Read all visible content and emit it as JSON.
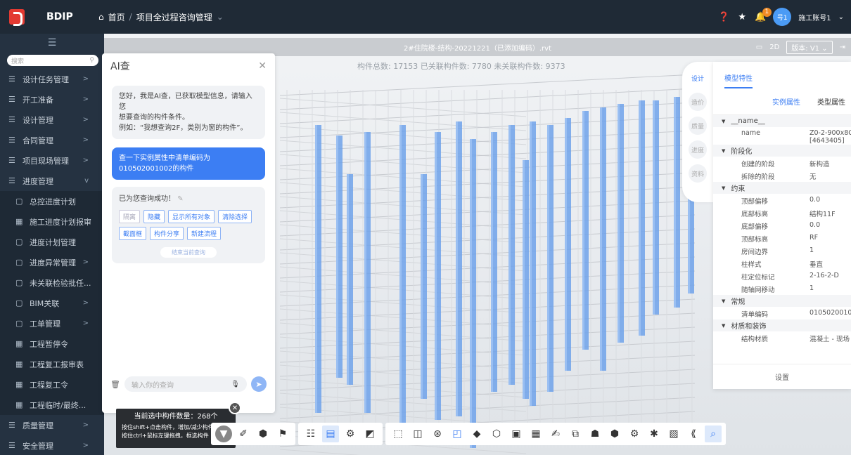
{
  "app": {
    "brand": "BDIP"
  },
  "breadcrumb": {
    "home": "首页",
    "separator": "/",
    "current": "项目全过程咨询管理"
  },
  "topright": {
    "notification_count": "1",
    "avatar_text": "号1",
    "user_name": "施工账号1"
  },
  "sidebar": {
    "search_placeholder": "搜索",
    "items": [
      {
        "label": "设计任务管理",
        "icon": "list-icon",
        "arrow": ">"
      },
      {
        "label": "开工准备",
        "icon": "list-icon",
        "arrow": ">"
      },
      {
        "label": "设计管理",
        "icon": "list-icon",
        "arrow": ">"
      },
      {
        "label": "合同管理",
        "icon": "list-icon",
        "arrow": ">"
      },
      {
        "label": "项目现场管理",
        "icon": "list-icon",
        "arrow": ">"
      },
      {
        "label": "进度管理",
        "icon": "list-icon",
        "arrow": "v"
      },
      {
        "label": "总控进度计划",
        "icon": "doc-icon",
        "arrow": "",
        "sub": true
      },
      {
        "label": "施工进度计划报审",
        "icon": "table-icon",
        "arrow": "",
        "sub": true
      },
      {
        "label": "进度计划管理",
        "icon": "doc-icon",
        "arrow": "",
        "sub": true
      },
      {
        "label": "进度异常管理",
        "icon": "doc-icon",
        "arrow": ">",
        "sub": true
      },
      {
        "label": "未关联检验批任...",
        "icon": "doc-icon",
        "arrow": "",
        "sub": true
      },
      {
        "label": "BIM关联",
        "icon": "doc-icon",
        "arrow": ">",
        "sub": true
      },
      {
        "label": "工单管理",
        "icon": "doc-icon",
        "arrow": ">",
        "sub": true
      },
      {
        "label": "工程暂停令",
        "icon": "table-icon",
        "arrow": "",
        "sub": true
      },
      {
        "label": "工程复工报审表",
        "icon": "table-icon",
        "arrow": "",
        "sub": true
      },
      {
        "label": "工程复工令",
        "icon": "table-icon",
        "arrow": "",
        "sub": true
      },
      {
        "label": "工程临时/最终...",
        "icon": "table-icon",
        "arrow": "",
        "sub": true
      },
      {
        "label": "质量管理",
        "icon": "list-icon",
        "arrow": ">"
      },
      {
        "label": "安全管理",
        "icon": "list-icon",
        "arrow": ">"
      }
    ]
  },
  "viewer": {
    "file_title": "2#住院楼-结构-20221221（已添加编码）.rvt",
    "mode_2d": "2D",
    "version": "版本: V1",
    "stats": "构件总数: 17153   已关联构件数: 7780   未关联构件数: 9373"
  },
  "ai_panel": {
    "title": "AI查",
    "greeting_lines": [
      "您好，我是AI查，已获取模型信息，请输入您",
      "想要查询的构件条件。",
      "例如：“我想查询2F，类别为窗的构件”。"
    ],
    "user_query": "查一下实例属性中清单编码为010502001002的构件",
    "result_text": "已为您查询成功！",
    "actions": [
      "隔离",
      "隐藏",
      "显示所有对象",
      "清除选择",
      "截面框",
      "构件分享",
      "新建流程"
    ],
    "end_query": "结束当前查询",
    "input_placeholder": "输入你的查询"
  },
  "selection": {
    "count_label": "当前选中构件数量：268个",
    "hint1": "按住shift+点击构件，增加/减少构件",
    "hint2": "按住ctrl+鼠标左键拖拽，框选构件"
  },
  "side_tabs": [
    "设计",
    "造价",
    "质量",
    "进度",
    "资料"
  ],
  "properties": {
    "title": "模型特性",
    "tab_instance": "实例属性",
    "tab_type": "类型属性",
    "footer": "设置",
    "groups": [
      {
        "name": "__name__",
        "rows": [
          {
            "k": "name",
            "v": "Z0-2-900x8C",
            "v2": "[4643405]"
          }
        ]
      },
      {
        "name": "阶段化",
        "rows": [
          {
            "k": "创建的阶段",
            "v": "新构造"
          },
          {
            "k": "拆除的阶段",
            "v": "无"
          }
        ]
      },
      {
        "name": "约束",
        "rows": [
          {
            "k": "顶部偏移",
            "v": "0.0"
          },
          {
            "k": "底部标高",
            "v": "结构11F"
          },
          {
            "k": "底部偏移",
            "v": "0.0"
          },
          {
            "k": "顶部标高",
            "v": "RF"
          },
          {
            "k": "房间边界",
            "v": "1"
          },
          {
            "k": "柱样式",
            "v": "垂直"
          },
          {
            "k": "柱定位标记",
            "v": "2-16-2-D"
          },
          {
            "k": "随轴网移动",
            "v": "1"
          }
        ]
      },
      {
        "name": "常规",
        "rows": [
          {
            "k": "清单编码",
            "v": "0105020010"
          }
        ]
      },
      {
        "name": "材质和装饰",
        "rows": [
          {
            "k": "结构材质",
            "v": "混凝土 - 现场"
          }
        ]
      }
    ]
  }
}
